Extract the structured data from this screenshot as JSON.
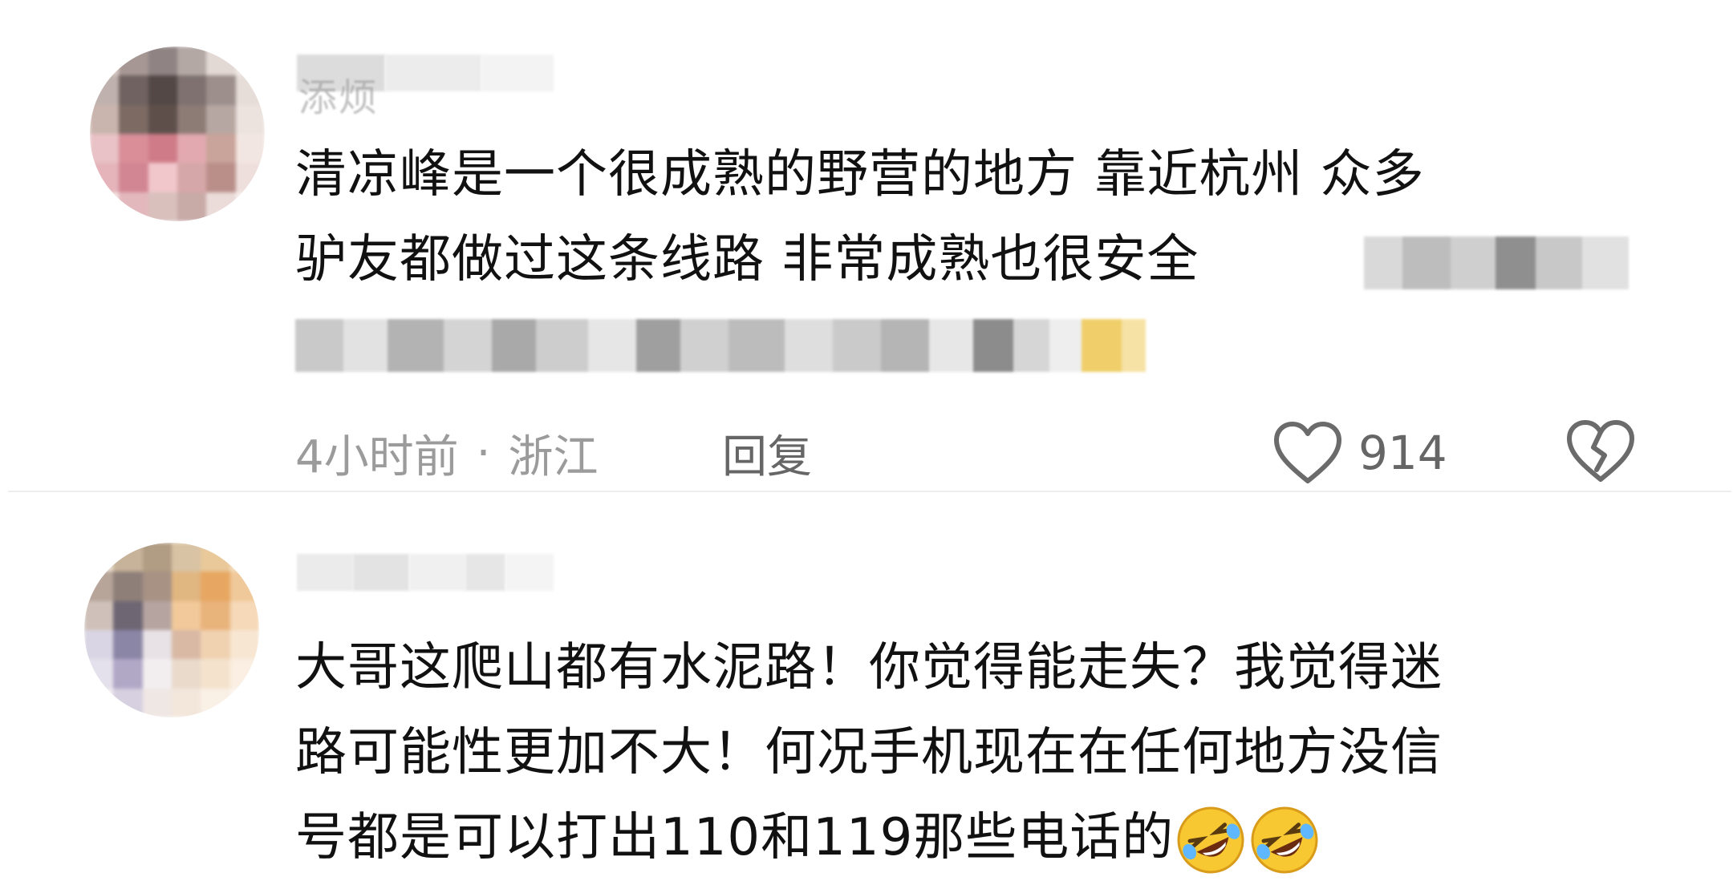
{
  "comments": [
    {
      "username_visible": "添烦",
      "lines": [
        "清凉峰是一个很成熟的野营的地方 靠近杭州 众多",
        "驴友都做过这条线路 非常成熟也很安全"
      ],
      "time": "4小时前",
      "separator": "·",
      "location": "浙江",
      "reply_label": "回复",
      "like_count": "914",
      "like_icon": "heart-outline-icon",
      "dislike_icon": "broken-heart-icon"
    },
    {
      "lines": [
        "大哥这爬山都有水泥路！你觉得能走失？我觉得迷",
        "路可能性更加不大！何况手机现在在任何地方没信",
        "号都是可以打出110和119那些电话的"
      ],
      "emoji": [
        "rolling-on-floor-laughing-icon",
        "rolling-on-floor-laughing-icon"
      ]
    }
  ],
  "colors": {
    "text": "#111111",
    "meta": "#9b9b9b",
    "divider": "#eeeeee"
  }
}
